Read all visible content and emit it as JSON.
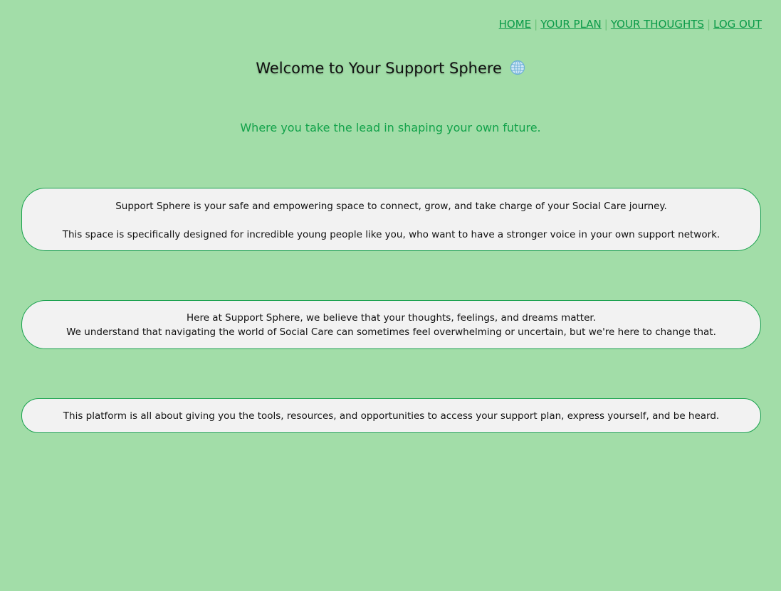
{
  "nav": {
    "home": "HOME",
    "plan": "YOUR PLAN",
    "thoughts": "YOUR THOUGHTS",
    "logout": "LOG OUT",
    "separator": "|"
  },
  "header": {
    "title": "Welcome to Your Support Sphere",
    "subtitle": "Where you take the lead in shaping your own future."
  },
  "cards": [
    {
      "lines": [
        "Support Sphere is your safe and empowering space to connect, grow, and take charge of your Social Care journey.",
        "This space is specifically designed for incredible young people like you, who want to have a stronger voice in your own support network."
      ]
    },
    {
      "lines": [
        "Here at Support Sphere, we believe that your thoughts, feelings, and dreams matter.",
        "We understand that navigating the world of Social Care can sometimes feel overwhelming or uncertain, but we're here to change that."
      ]
    },
    {
      "lines": [
        "This platform is all about giving you the tools, resources, and opportunities to access your support plan, express yourself, and be heard."
      ]
    }
  ],
  "icons": {
    "globe": "globe-icon"
  },
  "colors": {
    "background": "#a2dda8",
    "accent": "#0a9a48",
    "card": "#f2f2f2"
  }
}
